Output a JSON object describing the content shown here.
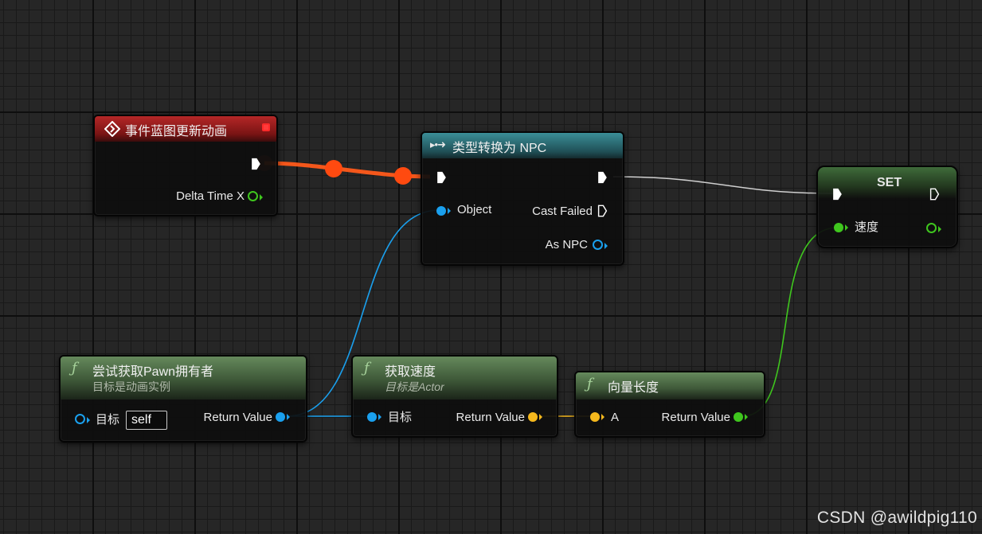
{
  "colors": {
    "exec_wire": "#f05a1f",
    "object_pin": "#1aa0ee",
    "float_pin": "#3fc61e",
    "vector_pin": "#f5b81d",
    "event_header": "#9a1c1c",
    "cast_header": "#2d6b74",
    "set_header": "#4b7c45",
    "function_header": "#4d6b46"
  },
  "nodes": {
    "event": {
      "title": "事件蓝图更新动画",
      "icon": "event-diamond-icon",
      "pin_delta": "Delta Time X"
    },
    "cast": {
      "title": "类型转换为 NPC",
      "pin_object": "Object",
      "pin_cast_failed": "Cast Failed",
      "pin_as": "As NPC"
    },
    "set": {
      "title": "SET",
      "pin_speed": "速度"
    },
    "get_owner": {
      "title": "尝试获取Pawn拥有者",
      "subtitle": "目标是动画实例",
      "pin_target": "目标",
      "target_value": "self",
      "pin_return": "Return Value"
    },
    "get_velocity": {
      "title": "获取速度",
      "subtitle": "目标是Actor",
      "pin_target": "目标",
      "pin_return": "Return Value"
    },
    "vector_length": {
      "title": "向量长度",
      "pin_a": "A",
      "pin_return": "Return Value"
    }
  },
  "watermark": "CSDN @awildpig110"
}
